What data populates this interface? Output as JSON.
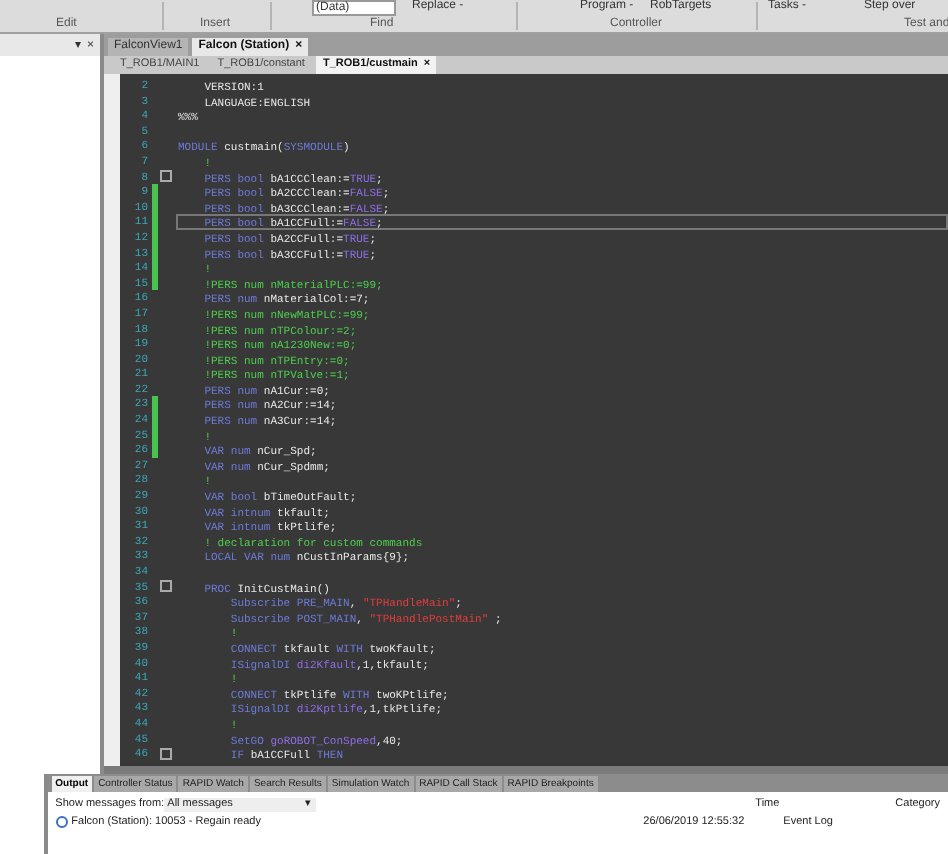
{
  "ribbon": {
    "items": [
      "(Data)",
      "Replace -",
      "Program -",
      "RobTargets",
      "Tasks -",
      "Step over"
    ],
    "groups": [
      "Edit",
      "Insert",
      "Find",
      "Controller",
      "Test and"
    ]
  },
  "left_panel": {
    "controls": [
      "▾",
      "×"
    ]
  },
  "document_tabs": [
    {
      "label": "FalconView1",
      "selected": false
    },
    {
      "label": "Falcon (Station)",
      "selected": true,
      "close": "×"
    }
  ],
  "file_tabs": [
    {
      "label": "T_ROB1/MAIN1",
      "selected": false
    },
    {
      "label": "T_ROB1/constant",
      "selected": false
    },
    {
      "label": "T_ROB1/custmain",
      "selected": true,
      "close": "×"
    }
  ],
  "editor": {
    "lines": [
      {
        "number": "2",
        "changed": false,
        "current": false,
        "fold": false,
        "tokens": [
          {
            "kind": "plain",
            "text": "    VERSION:1"
          }
        ]
      },
      {
        "number": "3",
        "changed": false,
        "current": false,
        "fold": false,
        "tokens": [
          {
            "kind": "plain",
            "text": "    LANGUAGE:ENGLISH"
          }
        ]
      },
      {
        "number": "4",
        "changed": false,
        "current": false,
        "fold": false,
        "tokens": [
          {
            "kind": "plain",
            "text": "%%%"
          }
        ]
      },
      {
        "number": "5",
        "changed": false,
        "current": false,
        "fold": false
      },
      {
        "number": "6",
        "changed": false,
        "current": false,
        "fold": false,
        "tokens": [
          {
            "kind": "keyword",
            "text": "MODULE"
          },
          {
            "kind": "plain",
            "text": " custmain("
          },
          {
            "kind": "keyword",
            "text": "SYSMODULE"
          },
          {
            "kind": "plain",
            "text": ")"
          }
        ]
      },
      {
        "number": "7",
        "changed": false,
        "current": false,
        "fold": false,
        "tokens": [
          {
            "kind": "comment",
            "text": "    !"
          }
        ]
      },
      {
        "number": "8",
        "changed": false,
        "current": false,
        "fold": true,
        "tokens": [
          {
            "kind": "keyword",
            "text": "    PERS bool"
          },
          {
            "kind": "plain",
            "text": " bA1CCClean:="
          },
          {
            "kind": "value",
            "text": "TRUE"
          },
          {
            "kind": "plain",
            "text": ";"
          }
        ]
      },
      {
        "number": "9",
        "changed": true,
        "current": false,
        "fold": false,
        "tokens": [
          {
            "kind": "keyword",
            "text": "    PERS bool"
          },
          {
            "kind": "plain",
            "text": " bA2CCClean:="
          },
          {
            "kind": "value",
            "text": "FALSE"
          },
          {
            "kind": "plain",
            "text": ";"
          }
        ]
      },
      {
        "number": "10",
        "changed": true,
        "current": false,
        "fold": false,
        "tokens": [
          {
            "kind": "keyword",
            "text": "    PERS bool"
          },
          {
            "kind": "plain",
            "text": " bA3CCClean:="
          },
          {
            "kind": "value",
            "text": "FALSE"
          },
          {
            "kind": "plain",
            "text": ";"
          }
        ]
      },
      {
        "number": "11",
        "changed": true,
        "current": true,
        "fold": false,
        "tokens": [
          {
            "kind": "keyword",
            "text": "    PERS bool"
          },
          {
            "kind": "plain",
            "text": " bA1CCFull:="
          },
          {
            "kind": "value",
            "text": "FALSE"
          },
          {
            "kind": "plain",
            "text": ";"
          }
        ]
      },
      {
        "number": "12",
        "changed": true,
        "current": false,
        "fold": false,
        "tokens": [
          {
            "kind": "keyword",
            "text": "    PERS bool"
          },
          {
            "kind": "plain",
            "text": " bA2CCFull:="
          },
          {
            "kind": "value",
            "text": "TRUE"
          },
          {
            "kind": "plain",
            "text": ";"
          }
        ]
      },
      {
        "number": "13",
        "changed": true,
        "current": false,
        "fold": false,
        "tokens": [
          {
            "kind": "keyword",
            "text": "    PERS bool"
          },
          {
            "kind": "plain",
            "text": " bA3CCFull:="
          },
          {
            "kind": "value",
            "text": "TRUE"
          },
          {
            "kind": "plain",
            "text": ";"
          }
        ]
      },
      {
        "number": "14",
        "changed": true,
        "current": false,
        "fold": false,
        "tokens": [
          {
            "kind": "comment",
            "text": "    !"
          }
        ]
      },
      {
        "number": "15",
        "changed": true,
        "current": false,
        "fold": false,
        "tokens": [
          {
            "kind": "comment",
            "text": "    !PERS num nMaterialPLC:=99;"
          }
        ]
      },
      {
        "number": "16",
        "changed": false,
        "current": false,
        "fold": false,
        "tokens": [
          {
            "kind": "keyword",
            "text": "    PERS num"
          },
          {
            "kind": "plain",
            "text": " nMaterialCol:=7;"
          }
        ]
      },
      {
        "number": "17",
        "changed": false,
        "current": false,
        "fold": false,
        "tokens": [
          {
            "kind": "comment",
            "text": "    !PERS num nNewMatPLC:=99;"
          }
        ]
      },
      {
        "number": "18",
        "changed": false,
        "current": false,
        "fold": false,
        "tokens": [
          {
            "kind": "comment",
            "text": "    !PERS num nTPColour:=2;"
          }
        ]
      },
      {
        "number": "19",
        "changed": false,
        "current": false,
        "fold": false,
        "tokens": [
          {
            "kind": "comment",
            "text": "    !PERS num nA1230New:=0;"
          }
        ]
      },
      {
        "number": "20",
        "changed": false,
        "current": false,
        "fold": false,
        "tokens": [
          {
            "kind": "comment",
            "text": "    !PERS num nTPEntry:=0;"
          }
        ]
      },
      {
        "number": "21",
        "changed": false,
        "current": false,
        "fold": false,
        "tokens": [
          {
            "kind": "comment",
            "text": "    !PERS num nTPValve:=1;"
          }
        ]
      },
      {
        "number": "22",
        "changed": false,
        "current": false,
        "fold": false,
        "tokens": [
          {
            "kind": "keyword",
            "text": "    PERS num"
          },
          {
            "kind": "plain",
            "text": " nA1Cur:=0;"
          }
        ]
      },
      {
        "number": "23",
        "changed": true,
        "current": false,
        "fold": false,
        "tokens": [
          {
            "kind": "keyword",
            "text": "    PERS num"
          },
          {
            "kind": "plain",
            "text": " nA2Cur:=14;"
          }
        ]
      },
      {
        "number": "24",
        "changed": true,
        "current": false,
        "fold": false,
        "tokens": [
          {
            "kind": "keyword",
            "text": "    PERS num"
          },
          {
            "kind": "plain",
            "text": " nA3Cur:=14;"
          }
        ]
      },
      {
        "number": "25",
        "changed": true,
        "current": false,
        "fold": false,
        "tokens": [
          {
            "kind": "comment",
            "text": "    !"
          }
        ]
      },
      {
        "number": "26",
        "changed": true,
        "current": false,
        "fold": false,
        "tokens": [
          {
            "kind": "keyword",
            "text": "    VAR num"
          },
          {
            "kind": "plain",
            "text": " nCur_Spd;"
          }
        ]
      },
      {
        "number": "27",
        "changed": false,
        "current": false,
        "fold": false,
        "tokens": [
          {
            "kind": "keyword",
            "text": "    VAR num"
          },
          {
            "kind": "plain",
            "text": " nCur_Spdmm;"
          }
        ]
      },
      {
        "number": "28",
        "changed": false,
        "current": false,
        "fold": false,
        "tokens": [
          {
            "kind": "comment",
            "text": "    !"
          }
        ]
      },
      {
        "number": "29",
        "changed": false,
        "current": false,
        "fold": false,
        "tokens": [
          {
            "kind": "keyword",
            "text": "    VAR bool"
          },
          {
            "kind": "plain",
            "text": " bTimeOutFault;"
          }
        ]
      },
      {
        "number": "30",
        "changed": false,
        "current": false,
        "fold": false,
        "tokens": [
          {
            "kind": "keyword",
            "text": "    VAR intnum"
          },
          {
            "kind": "plain",
            "text": " tkfault;"
          }
        ]
      },
      {
        "number": "31",
        "changed": false,
        "current": false,
        "fold": false,
        "tokens": [
          {
            "kind": "keyword",
            "text": "    VAR intnum"
          },
          {
            "kind": "plain",
            "text": " tkPtlife;"
          }
        ]
      },
      {
        "number": "32",
        "changed": false,
        "current": false,
        "fold": false,
        "tokens": [
          {
            "kind": "comment",
            "text": "    ! declaration for custom commands"
          }
        ]
      },
      {
        "number": "33",
        "changed": false,
        "current": false,
        "fold": false,
        "tokens": [
          {
            "kind": "keyword",
            "text": "    LOCAL VAR num"
          },
          {
            "kind": "plain",
            "text": " nCustInParams{9};"
          }
        ]
      },
      {
        "number": "34",
        "changed": false,
        "current": false,
        "fold": false
      },
      {
        "number": "35",
        "changed": false,
        "current": false,
        "fold": true,
        "tokens": [
          {
            "kind": "keyword",
            "text": "    PROC"
          },
          {
            "kind": "plain",
            "text": " InitCustMain()"
          }
        ]
      },
      {
        "number": "36",
        "changed": false,
        "current": false,
        "fold": false,
        "tokens": [
          {
            "kind": "keyword",
            "text": "        Subscribe PRE_MAIN"
          },
          {
            "kind": "plain",
            "text": ", "
          },
          {
            "kind": "string",
            "text": "\"TPHandleMain\""
          },
          {
            "kind": "plain",
            "text": ";"
          }
        ]
      },
      {
        "number": "37",
        "changed": false,
        "current": false,
        "fold": false,
        "tokens": [
          {
            "kind": "keyword",
            "text": "        Subscribe POST_MAIN"
          },
          {
            "kind": "plain",
            "text": ", "
          },
          {
            "kind": "string",
            "text": "\"TPHandlePostMain\""
          },
          {
            "kind": "plain",
            "text": " ;"
          }
        ]
      },
      {
        "number": "38",
        "changed": false,
        "current": false,
        "fold": false,
        "tokens": [
          {
            "kind": "comment",
            "text": "        !"
          }
        ]
      },
      {
        "number": "39",
        "changed": false,
        "current": false,
        "fold": false,
        "tokens": [
          {
            "kind": "keyword",
            "text": "        CONNECT"
          },
          {
            "kind": "plain",
            "text": " tkfault "
          },
          {
            "kind": "keyword",
            "text": "WITH"
          },
          {
            "kind": "plain",
            "text": " twoKfault;"
          }
        ]
      },
      {
        "number": "40",
        "changed": false,
        "current": false,
        "fold": false,
        "tokens": [
          {
            "kind": "keyword",
            "text": "        ISignalDI"
          },
          {
            "kind": "value",
            "text": " di2Kfault"
          },
          {
            "kind": "plain",
            "text": ",1,tkfault;"
          }
        ]
      },
      {
        "number": "41",
        "changed": false,
        "current": false,
        "fold": false,
        "tokens": [
          {
            "kind": "comment",
            "text": "        !"
          }
        ]
      },
      {
        "number": "42",
        "changed": false,
        "current": false,
        "fold": false,
        "tokens": [
          {
            "kind": "keyword",
            "text": "        CONNECT"
          },
          {
            "kind": "plain",
            "text": " tkPtlife "
          },
          {
            "kind": "keyword",
            "text": "WITH"
          },
          {
            "kind": "plain",
            "text": " twoKPtlife;"
          }
        ]
      },
      {
        "number": "43",
        "changed": false,
        "current": false,
        "fold": false,
        "tokens": [
          {
            "kind": "keyword",
            "text": "        ISignalDI"
          },
          {
            "kind": "value",
            "text": " di2Kptlife"
          },
          {
            "kind": "plain",
            "text": ",1,tkPtlife;"
          }
        ]
      },
      {
        "number": "44",
        "changed": false,
        "current": false,
        "fold": false,
        "tokens": [
          {
            "kind": "comment",
            "text": "        !"
          }
        ]
      },
      {
        "number": "45",
        "changed": false,
        "current": false,
        "fold": false,
        "tokens": [
          {
            "kind": "keyword",
            "text": "        SetGO"
          },
          {
            "kind": "value",
            "text": " goROBOT_ConSpeed"
          },
          {
            "kind": "plain",
            "text": ",40;"
          }
        ]
      },
      {
        "number": "46",
        "changed": false,
        "current": false,
        "fold": true,
        "tokens": [
          {
            "kind": "keyword",
            "text": "        IF"
          },
          {
            "kind": "plain",
            "text": " bA1CCFull "
          },
          {
            "kind": "keyword",
            "text": "THEN"
          }
        ]
      }
    ]
  },
  "output": {
    "tabs": [
      {
        "label": "Output",
        "selected": true
      },
      {
        "label": "Controller Status",
        "selected": false
      },
      {
        "label": "RAPID Watch",
        "selected": false
      },
      {
        "label": "Search Results",
        "selected": false
      },
      {
        "label": "Simulation Watch",
        "selected": false
      },
      {
        "label": "RAPID Call Stack",
        "selected": false
      },
      {
        "label": "RAPID Breakpoints",
        "selected": false
      }
    ],
    "filter_label": "Show messages from:",
    "filter_value": "All messages",
    "filter_caret": "▾",
    "columns": [
      "Time",
      "Category"
    ],
    "rows": [
      {
        "message": "Falcon (Station): 10053 - Regain ready",
        "time": "26/06/2019 12:55:32",
        "category": "Event Log"
      }
    ]
  }
}
